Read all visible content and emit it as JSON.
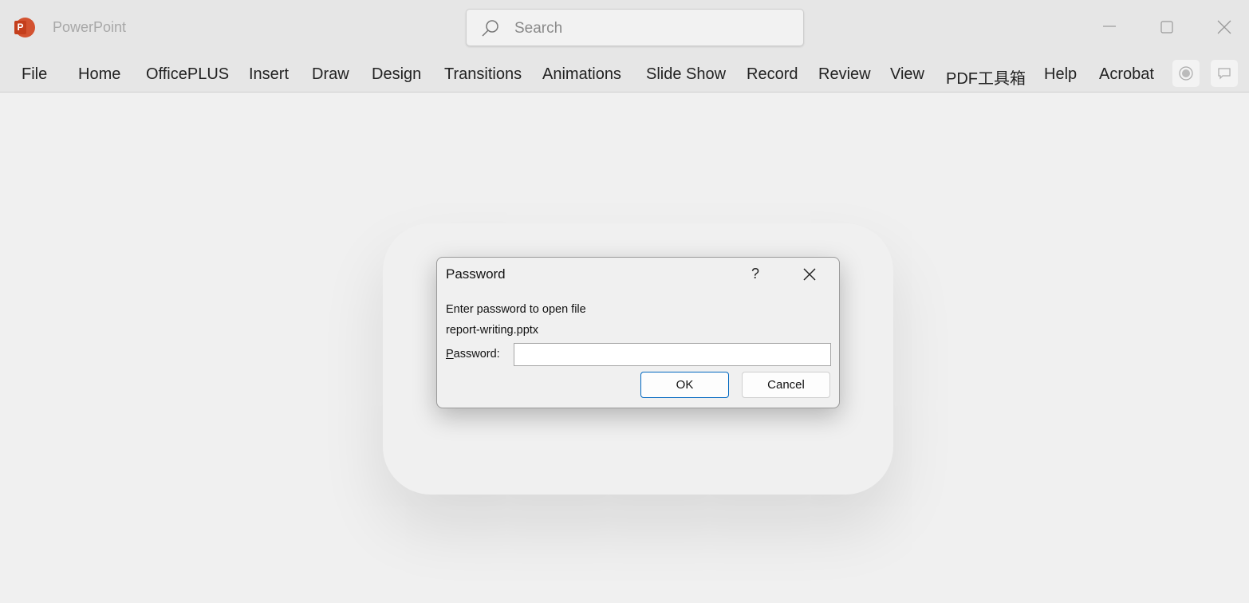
{
  "app": {
    "name": "PowerPoint",
    "logo_letter": "P"
  },
  "search": {
    "placeholder": "Search"
  },
  "ribbon": {
    "tabs": [
      "File",
      "Home",
      "OfficePLUS",
      "Insert",
      "Draw",
      "Design",
      "Transitions",
      "Animations",
      "Slide Show",
      "Record",
      "Review",
      "View",
      "PDF工具箱",
      "Help",
      "Acrobat"
    ]
  },
  "dialog": {
    "title": "Password",
    "help": "?",
    "message": "Enter password to open file",
    "filename": "report-writing.pptx",
    "field_label_accel": "P",
    "field_label_rest": "assword:",
    "password_value": "",
    "ok_label": "OK",
    "cancel_label": "Cancel"
  },
  "colors": {
    "accent": "#0067c0",
    "brand": "#d35230"
  }
}
